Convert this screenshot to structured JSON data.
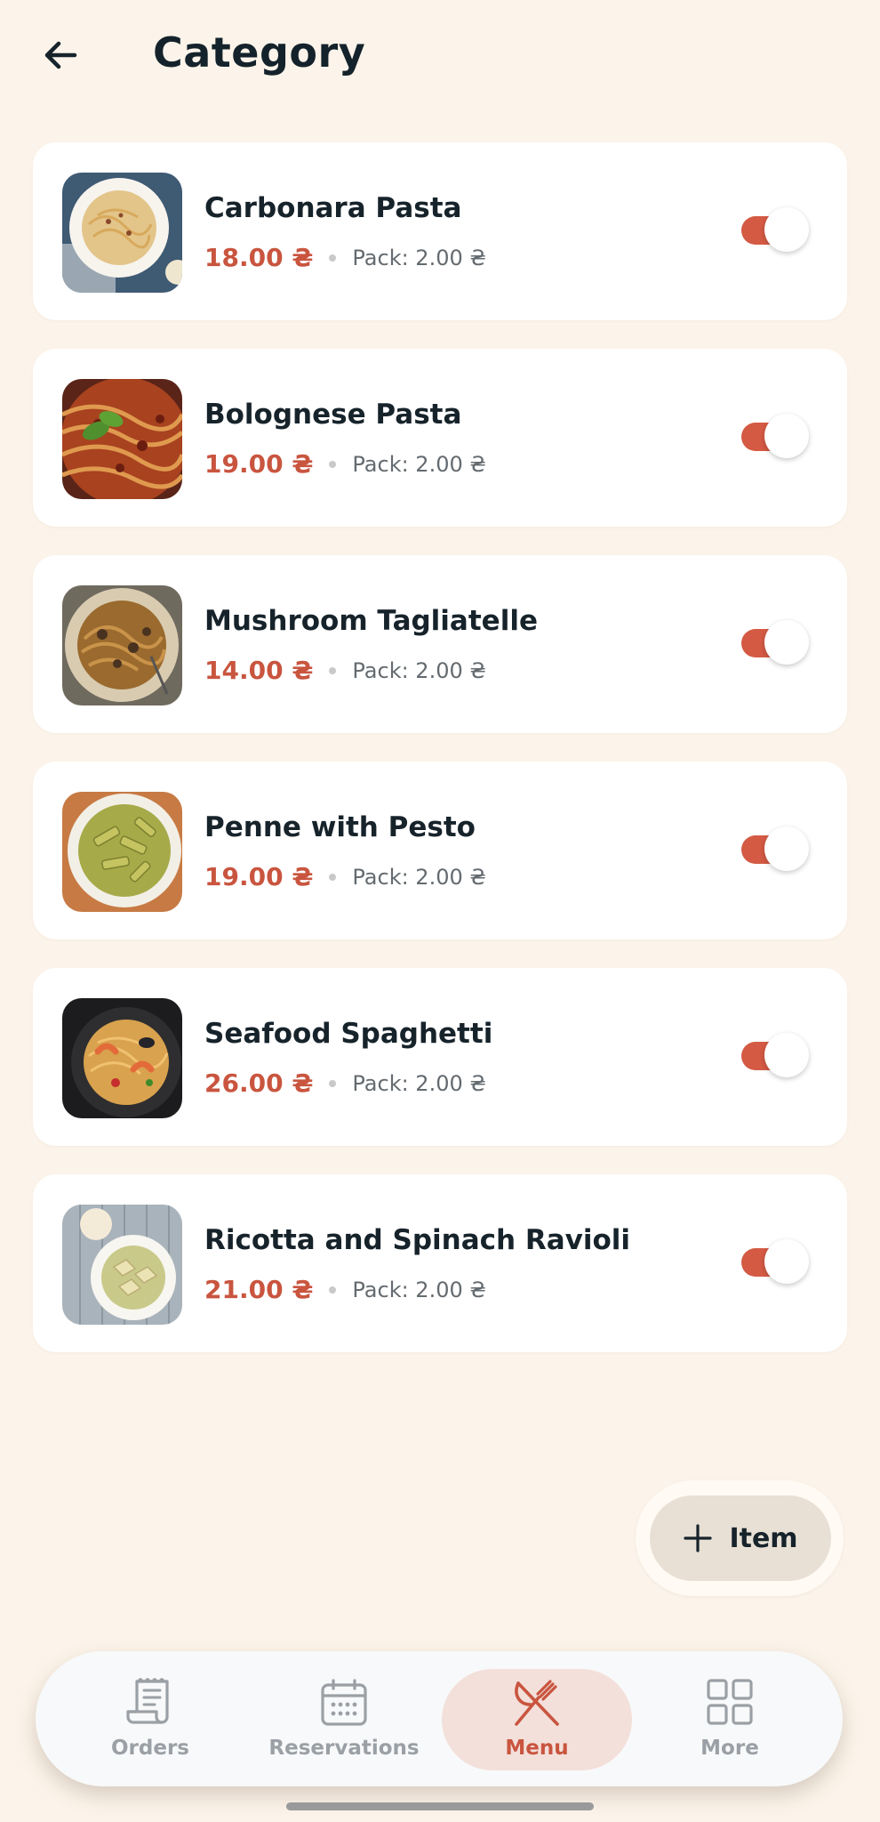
{
  "header": {
    "title": "Category"
  },
  "items": [
    {
      "name": "Carbonara Pasta",
      "price": "18.00 ₴",
      "pack": "Pack: 2.00 ₴",
      "enabled": true
    },
    {
      "name": "Bolognese Pasta",
      "price": "19.00 ₴",
      "pack": "Pack: 2.00 ₴",
      "enabled": true
    },
    {
      "name": "Mushroom Tagliatelle",
      "price": "14.00 ₴",
      "pack": "Pack: 2.00 ₴",
      "enabled": true
    },
    {
      "name": "Penne with Pesto",
      "price": "19.00 ₴",
      "pack": "Pack: 2.00 ₴",
      "enabled": true
    },
    {
      "name": "Seafood Spaghetti",
      "price": "26.00 ₴",
      "pack": "Pack: 2.00 ₴",
      "enabled": true
    },
    {
      "name": "Ricotta and Spinach Ravioli",
      "price": "21.00 ₴",
      "pack": "Pack: 2.00 ₴",
      "enabled": true
    }
  ],
  "fab": {
    "label": "Item",
    "icon": "plus-icon"
  },
  "nav": {
    "items": [
      {
        "label": "Orders",
        "icon": "receipt-icon",
        "active": false
      },
      {
        "label": "Reservations",
        "icon": "calendar-icon",
        "active": false
      },
      {
        "label": "Menu",
        "icon": "fork-knife-icon",
        "active": true
      },
      {
        "label": "More",
        "icon": "grid-icon",
        "active": false
      }
    ]
  },
  "colors": {
    "background": "#fcf4ea",
    "accent": "#c9553f",
    "toggle_on": "#d45a44",
    "card": "#ffffff",
    "fab": "#e8e0d5",
    "active_pill": "#f3e0da"
  }
}
